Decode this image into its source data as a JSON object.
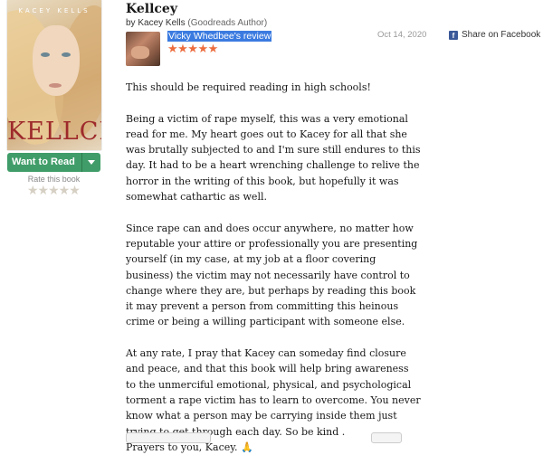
{
  "book": {
    "cover_author": "KACEY KELLS",
    "cover_title": "KELLCEY",
    "title": "Kellcey",
    "by": "by",
    "author": "Kacey Kells",
    "author_badge": "(Goodreads Author)"
  },
  "shelf": {
    "want_to_read_label": "Want to Read",
    "rate_label": "Rate this book",
    "rate_stars": "★★★★★"
  },
  "review": {
    "reviewer_label": "Vicky Whedbee's review",
    "rating_stars": "★★★★★",
    "date": "Oct 14, 2020",
    "share_label": "Share on Facebook",
    "paragraphs": [
      "This should be required reading in high schools!",
      "Being a victim of rape myself, this was a very emotional read for me. My heart goes out to Kacey for all that she was brutally subjected to and I'm sure still endures to this day. It had to be a heart wrenching challenge to relive the horror in the writing of this book, but hopefully it was somewhat cathartic as well.",
      "Since rape can and does occur anywhere, no matter how reputable your attire or professionally you are presenting yourself (in my case, at my job at a floor covering business) the victim may not necessarily have control to change where they are, but perhaps by reading this book it may prevent a person from committing this heinous crime or being a willing participant with someone else.",
      "At any rate, I pray that Kacey can someday find closure and peace, and that this book will help bring awareness to the unmerciful emotional, physical, and psychological torment a rape victim has to learn to overcome. You never know what a person may be carrying inside them just trying to get through each day. So be kind ."
    ],
    "closing": "Prayers to you, Kacey.",
    "closing_emoji": "🙏"
  },
  "colors": {
    "want_button": "#409d69",
    "reviewer_highlight": "#3b7be0",
    "rating_star": "#ec6d3f",
    "facebook": "#3b5998",
    "cover_title": "#9e2a2b"
  },
  "icons": {
    "share": "facebook-icon",
    "dropdown": "chevron-down-icon",
    "closing": "praying-hands-icon"
  }
}
